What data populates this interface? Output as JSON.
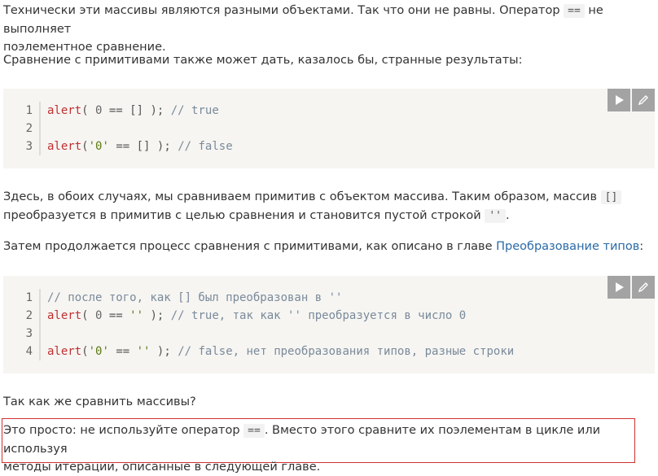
{
  "paragraphs": {
    "p1_a": "Технически эти массивы являются разными объектами. Так что они не равны. Оператор",
    "p1_code": "==",
    "p1_b": "не выполняет",
    "p1_c": "поэлементное сравнение.",
    "p2": "Сравнение с примитивами также может дать, казалось бы, странные результаты:",
    "p3_a": "Здесь, в обоих случаях, мы сравниваем примитив с объектом массива. Таким образом, массив",
    "p3_code1": "[]",
    "p3_b": "преобразуется в примитив с целью сравнения и становится пустой строкой",
    "p3_code2": "''",
    "p3_c": ".",
    "p4_a": "Затем продолжается процесс сравнения с примитивами, как описано в главе",
    "p4_link": "Преобразование типов",
    "p4_b": ":",
    "p5": "Так как же сравнить массивы?",
    "p6_a": "Это просто: не используйте оператор",
    "p6_code": "==",
    "p6_b": ". Вместо этого сравните их поэлементам в цикле или используя",
    "p6_c": "методы итерации, описанные в следующей главе."
  },
  "code1": {
    "lines": [
      {
        "n": "1",
        "fn": "alert",
        "rest1": "( ",
        "arg": "0",
        "rest2": " == [] ); ",
        "cmt": "// true"
      },
      {
        "n": "2"
      },
      {
        "n": "3",
        "fn": "alert",
        "rest1": "(",
        "arg": "'0'",
        "rest2": " == [] ); ",
        "cmt": "// false"
      }
    ]
  },
  "code2": {
    "lines": [
      {
        "n": "1",
        "cmt": "// после того, как [] был преобразован в ''"
      },
      {
        "n": "2",
        "fn": "alert",
        "rest1": "( ",
        "arg": "0",
        "rest2": " == ",
        "str": "''",
        "rest3": " ); ",
        "cmt": "// true, так как '' преобразуется в число 0"
      },
      {
        "n": "3"
      },
      {
        "n": "4",
        "fn": "alert",
        "rest1": "(",
        "arg": "'0'",
        "rest2": " == ",
        "str": "''",
        "rest3": " ); ",
        "cmt": "// false, нет преобразования типов, разные строки"
      }
    ]
  },
  "icons": {
    "run": "play-icon",
    "edit": "pencil-icon"
  },
  "colors": {
    "link": "#2a6aa8",
    "highlight_border": "#d03030",
    "code_bg": "#f6f5f2",
    "button_bg": "#a3a3a3"
  }
}
